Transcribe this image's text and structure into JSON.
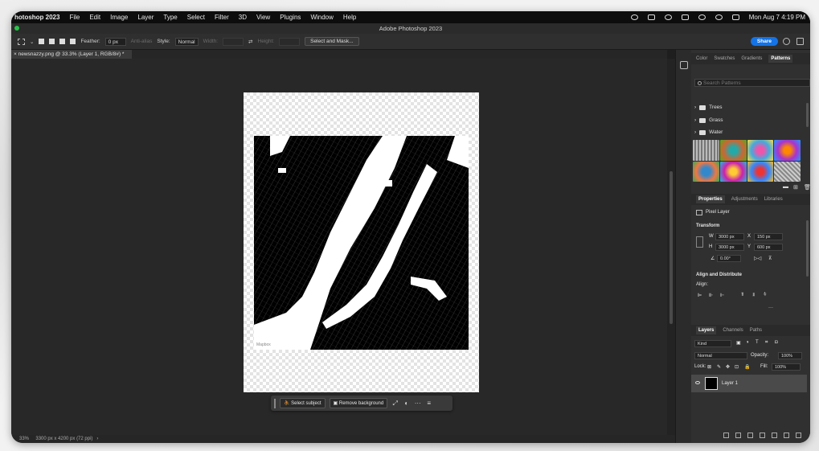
{
  "menubar": {
    "app": "hotoshop 2023",
    "items": [
      "File",
      "Edit",
      "Image",
      "Layer",
      "Type",
      "Select",
      "Filter",
      "3D",
      "View",
      "Plugins",
      "Window",
      "Help"
    ],
    "clock": "Mon Aug 7  4:19 PM"
  },
  "window": {
    "title": "Adobe Photoshop 2023"
  },
  "options": {
    "feather_label": "Feather:",
    "feather_value": "0 px",
    "antialias": "Anti-alias",
    "style_label": "Style:",
    "style_value": "Normal",
    "width_label": "Width:",
    "height_label": "Height:",
    "select_mask": "Select and Mask...",
    "share": "Share"
  },
  "document": {
    "tab_title": "newsnazzy.png @ 33.3% (Layer 1, RGB/8#) *",
    "map_credit": "Mapbox"
  },
  "context_bar": {
    "select_subject": "Select subject",
    "remove_background": "Remove background",
    "more": "···"
  },
  "status": {
    "zoom": "33%",
    "doc_info": "3300 px x 4200 px (72 ppi)"
  },
  "patterns_panel": {
    "tabs": [
      "Color",
      "Swatches",
      "Gradients",
      "Patterns"
    ],
    "active_tab": "Patterns",
    "search_placeholder": "Search Patterns",
    "folders": [
      "Trees",
      "Grass",
      "Water"
    ]
  },
  "properties_panel": {
    "tabs": [
      "Properties",
      "Adjustments",
      "Libraries"
    ],
    "layer_type": "Pixel Layer",
    "transform_header": "Transform",
    "w_label": "W",
    "w_value": "3000 px",
    "x_label": "X",
    "x_value": "150 px",
    "h_label": "H",
    "h_value": "3000 px",
    "y_label": "Y",
    "y_value": "600 px",
    "angle_value": "0.00°",
    "align_header": "Align and Distribute",
    "align_label": "Align:",
    "more": "···"
  },
  "layers_panel": {
    "tabs": [
      "Layers",
      "Channels",
      "Paths"
    ],
    "kind": "Kind",
    "blend_mode": "Normal",
    "opacity_label": "Opacity:",
    "opacity_value": "100%",
    "lock_label": "Lock:",
    "fill_label": "Fill:",
    "fill_value": "100%",
    "layer_name": "Layer 1"
  },
  "colors": {
    "accent": "#1473e6",
    "window_bg": "#1e1e1e",
    "panel_bg": "#303030"
  }
}
